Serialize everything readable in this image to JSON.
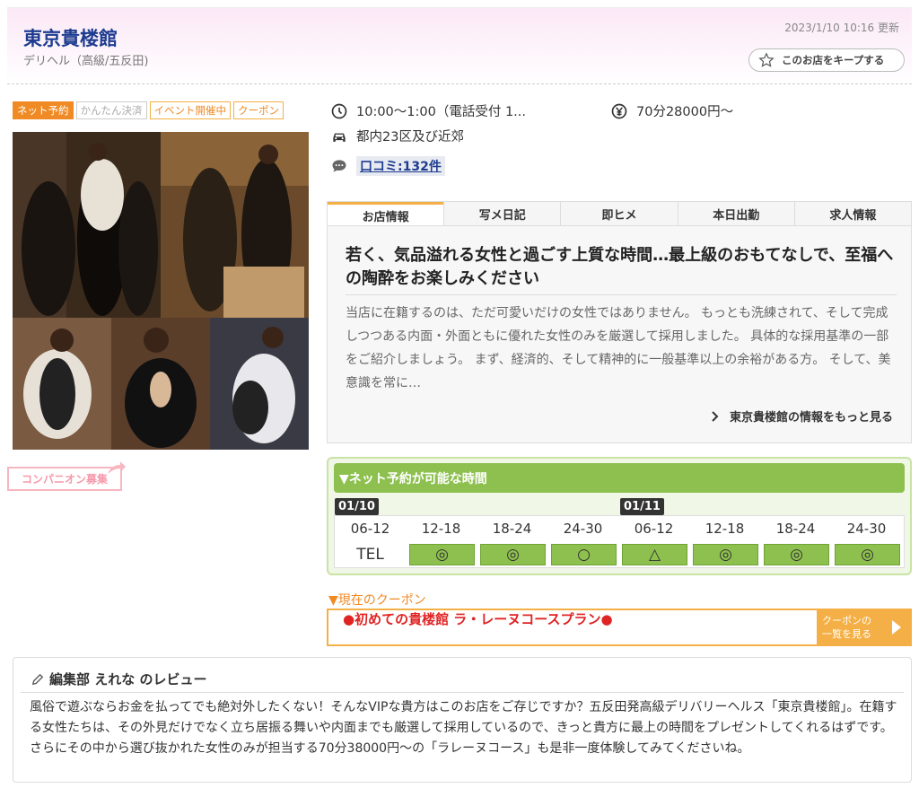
{
  "header": {
    "shop_name": "東京貴楼館",
    "category": "デリヘル（高級/五反田)",
    "updated": "2023/1/10 10:16 更新",
    "keep_label": "このお店をキープする"
  },
  "badges": [
    "ネット予約",
    "かんたん決済",
    "イベント開催中",
    "クーポン"
  ],
  "companion_label": "コンパニオン募集",
  "info": {
    "hours": "10:00〜1:00（電話受付 1...",
    "price": "70分28000円〜",
    "area": "都内23区及び近郊",
    "reviews": "口コミ:132件"
  },
  "tabs": [
    "お店情報",
    "写メ日記",
    "即ヒメ",
    "本日出勤",
    "求人情報"
  ],
  "shop_info": {
    "catch": "若く、気品溢れる女性と過ごす上質な時間…最上級のおもてなしで、至福への陶酔をお楽しみください",
    "intro": "当店に在籍するのは、ただ可愛いだけの女性ではありません。 もっとも洗練されて、そして完成しつつある内面・外面ともに優れた女性のみを厳選して採用しました。 具体的な採用基準の一部をご紹介しましょう。 まず、経済的、そして精神的に一般基準以上の余裕がある方。 そして、美意識を常に…",
    "more_link": "東京貴楼館の情報をもっと見る"
  },
  "reservation": {
    "title": "▼ネット予約が可能な時間",
    "dates": [
      "01/10",
      "01/11"
    ],
    "slots": [
      "06-12",
      "12-18",
      "18-24",
      "24-30",
      "06-12",
      "12-18",
      "18-24",
      "24-30"
    ],
    "marks": [
      "TEL",
      "◎",
      "◎",
      "○",
      "△",
      "◎",
      "◎",
      "◎"
    ]
  },
  "coupon": {
    "label": "▼現在のクーポン",
    "text": "●初めての貴楼館 ラ・レーヌコースプラン●",
    "button_line1": "クーポンの",
    "button_line2": "一覧を見る"
  },
  "review": {
    "title": "編集部 えれな のレビュー",
    "body": "風俗で遊ぶならお金を払ってでも絶対外したくない！そんなVIPな貴方はこのお店をご存じですか？五反田発高級デリバリーヘルス「東京貴楼館」。在籍する女性たちは、その外見だけでなく立ち居振る舞いや内面までも厳選して採用しているので、きっと貴方に最上の時間をプレゼントしてくれるはずです。さらにその中から選び抜かれた女性のみが担当する70分38000円〜の「ラレーヌコース」も是非一度体験してみてくださいね。"
  },
  "colors": {
    "brand_blue": "#1d3b8f",
    "accent_orange": "#f08a24",
    "resv_green": "#8dc04e",
    "coupon_red": "#e02424"
  }
}
